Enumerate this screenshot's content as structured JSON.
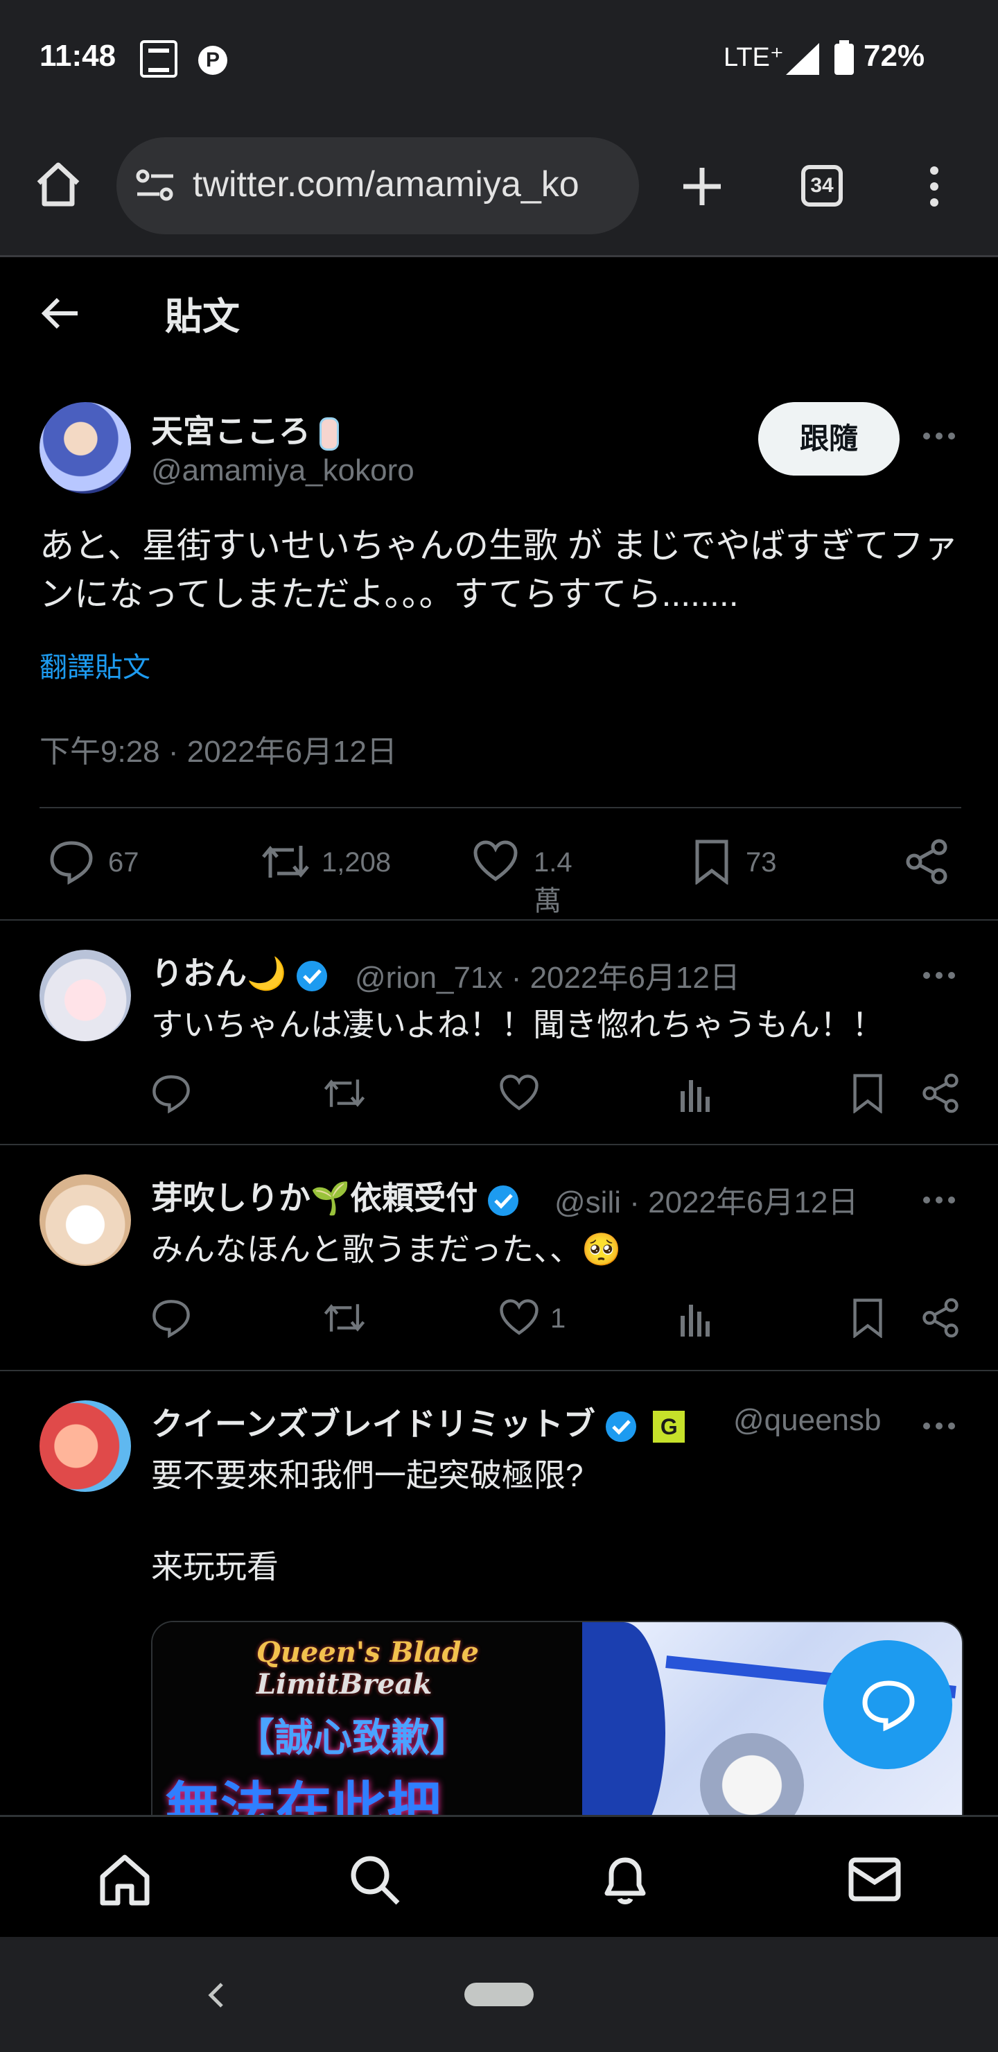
{
  "status_bar": {
    "time": "11:48",
    "network": "LTE⁺",
    "battery": "72%"
  },
  "browser": {
    "url": "twitter.com/amamiya_ko",
    "tab_count": "34"
  },
  "header": {
    "title": "貼文"
  },
  "main_tweet": {
    "display_name": "天宮こころ",
    "handle": "@amamiya_kokoro",
    "follow_label": "跟隨",
    "text": "あと、星街すいせいちゃんの生歌 が まじでやばすぎてファンになってしまただよ。。。すてらすてら........",
    "translate_label": "翻譯貼文",
    "timestamp": "下午9:28 · 2022年6月12日",
    "stats": {
      "replies": "67",
      "reposts": "1,208",
      "likes": "1.4萬",
      "bookmarks": "73"
    }
  },
  "replies": [
    {
      "display_name": "りおん🌙",
      "handle": "@rion_71x",
      "date": "· 2022年6月12日",
      "text": "すいちゃんは凄いよね！！聞き惚れちゃうもん！！",
      "likes": ""
    },
    {
      "display_name": "芽吹しりか🌱依頼受付",
      "handle": "@sili",
      "date": "· 2022年6月12日",
      "text": "みんなほんと歌うまだった、、🥺",
      "likes": "1"
    },
    {
      "display_name": "クイーンズブレイドリミットブ",
      "handle": "@queensb",
      "date": "",
      "text_lines": [
        "要不要來和我們一起突破極限?",
        "来玩玩看"
      ],
      "ad_badge": "G"
    }
  ],
  "ad_image": {
    "logo_line1": "Queen's Blade",
    "logo_line2": "LimitBreak",
    "banner": "【誠心致歉】",
    "headline": "無法在此把"
  },
  "colors": {
    "accent": "#1d9bf0",
    "background": "#000000",
    "secondary_text": "#71767b",
    "chrome": "#1f2023"
  },
  "icons": [
    "home-icon",
    "search-icon",
    "bell-icon",
    "mail-icon",
    "back-arrow-icon",
    "share-icon",
    "compose-message-icon"
  ]
}
